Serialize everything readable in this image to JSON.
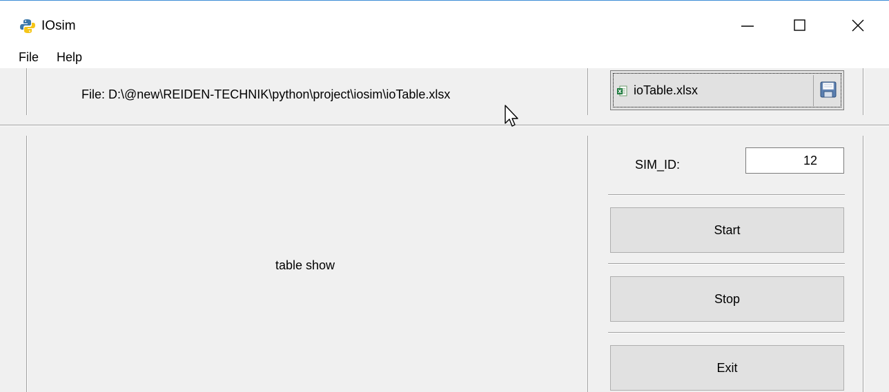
{
  "window": {
    "title": "IOsim",
    "controls": {
      "minimize": "minimize",
      "maximize": "maximize",
      "close": "close"
    }
  },
  "menu": {
    "items": [
      "File",
      "Help"
    ]
  },
  "file_panel": {
    "label": "File:  D:\\@new\\REIDEN-TECHNIK\\python\\project\\iosim\\ioTable.xlsx",
    "button_label": "ioTable.xlsx",
    "button_icon": "excel-file-icon",
    "save_icon": "floppy-save-icon"
  },
  "table_panel": {
    "placeholder": "table show"
  },
  "control_panel": {
    "sim_id_label": "SIM_ID:",
    "sim_id_value": "12",
    "start_label": "Start",
    "stop_label": "Stop",
    "exit_label": "Exit"
  },
  "colors": {
    "window_border": "#3c8cd6",
    "panel_bg": "#f0f0f0",
    "button_bg": "#e1e1e1"
  }
}
